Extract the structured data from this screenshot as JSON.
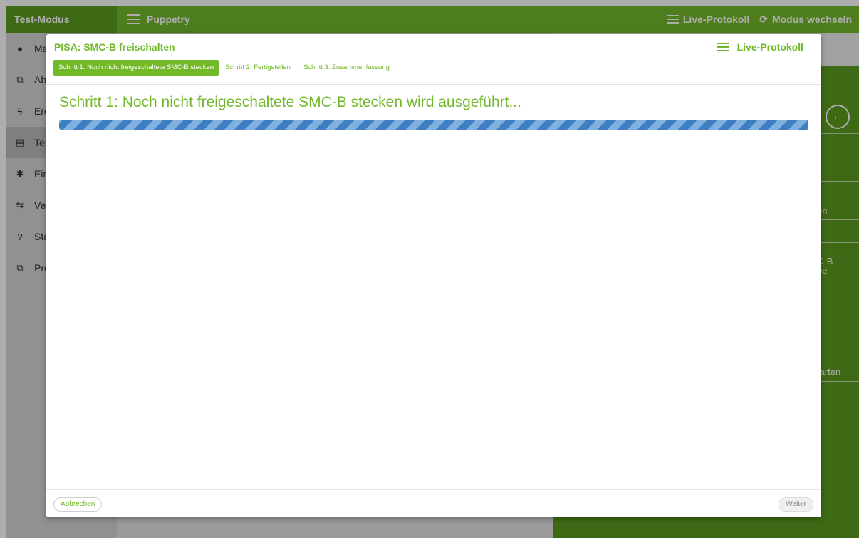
{
  "app": {
    "mode_title": "Test-Modus",
    "menu_label": "Puppetry",
    "live_protocol": "Live-Protokoll",
    "switch_mode": "Modus wechseln",
    "sidebar": [
      {
        "icon": "user-icon",
        "glyph": "👤",
        "label": "Ma"
      },
      {
        "icon": "documents-icon",
        "glyph": "⧉",
        "label": "Ab"
      },
      {
        "icon": "lightning-icon",
        "glyph": "ϟ",
        "label": "Ere"
      },
      {
        "icon": "clipboard-icon",
        "glyph": "▤",
        "label": "Tes"
      },
      {
        "icon": "gear-icon",
        "glyph": "✱",
        "label": "Ein"
      },
      {
        "icon": "connection-icon",
        "glyph": "⇆",
        "label": "Ve"
      },
      {
        "icon": "question-icon",
        "glyph": "?",
        "label": "Sta"
      },
      {
        "icon": "copy-icon",
        "glyph": "⧉",
        "label": "Pro"
      }
    ],
    "right_panel": {
      "box2_text": "en",
      "box3_text": "C-B\nbe",
      "box4_text": "tarten"
    }
  },
  "modal": {
    "title": "PISA: SMC-B freischalten",
    "live_protocol": "Live-Protokoll",
    "steps": [
      {
        "label": "Schritt 1: Noch nicht freigeschaltete SMC-B stecken",
        "active": true
      },
      {
        "label": "Schritt 2: Fertigstellen",
        "active": false
      },
      {
        "label": "Schritt 3: Zusammenfassung",
        "active": false
      }
    ],
    "status_text": "Schritt 1: Noch nicht freigeschaltete SMC-B stecken wird ausgeführt...",
    "progress": 1.0,
    "cancel_label": "Abbrechen",
    "next_label": "Weiter"
  },
  "colors": {
    "accent": "#72b92a",
    "accent_dark": "#5e9d1f",
    "progress_stripe_dark": "#3e7fc2",
    "progress_stripe_light": "#7fb0e0"
  }
}
